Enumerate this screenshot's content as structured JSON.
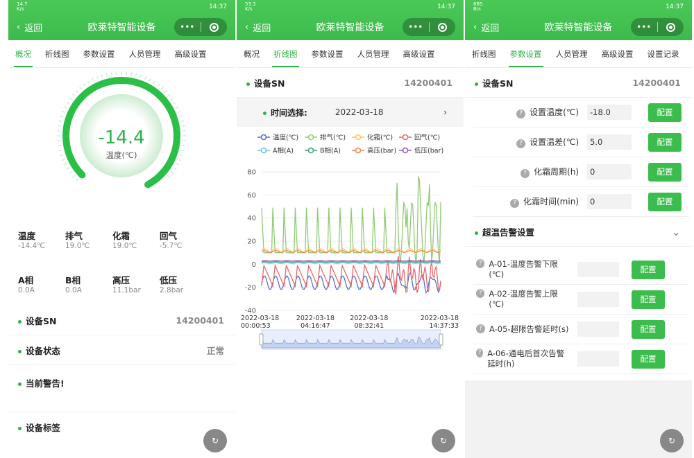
{
  "status": {
    "p1": {
      "net": "14.7\nK/s",
      "time": "14:37"
    },
    "p2": {
      "net": "53.3\nK/s",
      "time": "14:37"
    },
    "p3": {
      "net": "685\nB/s",
      "time": "14:37"
    }
  },
  "nav": {
    "back": "返回",
    "title": "欧莱特智能设备"
  },
  "p1": {
    "tabs": [
      "概况",
      "折线图",
      "参数设置",
      "人员管理",
      "高级设置"
    ],
    "gauge": {
      "value": "-14.4",
      "unit": "温度(℃)"
    },
    "metrics1": [
      {
        "label": "温度",
        "value": "-14.4℃"
      },
      {
        "label": "排气",
        "value": "19.0℃"
      },
      {
        "label": "化霜",
        "value": "19.0℃"
      },
      {
        "label": "回气",
        "value": "-5.7℃"
      }
    ],
    "metrics2": [
      {
        "label": "A相",
        "value": "0.0A"
      },
      {
        "label": "B相",
        "value": "0.0A"
      },
      {
        "label": "高压",
        "value": "11.1bar"
      },
      {
        "label": "低压",
        "value": "2.8bar"
      }
    ],
    "sn_label": "设备SN",
    "sn_value": "14200401",
    "status_label": "设备状态",
    "status_value": "正常",
    "alarm_label": "当前警告!",
    "tag_label": "设备标签"
  },
  "p2": {
    "tabs": [
      "概况",
      "折线图",
      "参数设置",
      "人员管理",
      "高级设置"
    ],
    "sn_label": "设备SN",
    "sn_value": "14200401",
    "time_label": "时间选择:",
    "time_value": "2022-03-18"
  },
  "p3": {
    "tabs": [
      "折线图",
      "参数设置",
      "人员管理",
      "高级设置",
      "设置记录"
    ],
    "sn_label": "设备SN",
    "sn_value": "14200401",
    "params": [
      {
        "label": "设置温度(℃)",
        "value": "-18.0",
        "btn": "配置"
      },
      {
        "label": "设置温差(℃)",
        "value": "5.0",
        "btn": "配置"
      },
      {
        "label": "化霜周期(h)",
        "value": "0",
        "btn": "配置"
      },
      {
        "label": "化霜时间(min)",
        "value": "0",
        "btn": "配置"
      }
    ],
    "alarm_section": "超温告警设置",
    "alarms": [
      {
        "label": "A-01-温度告警下限(℃)",
        "btn": "配置"
      },
      {
        "label": "A-02-温度告警上限(℃)",
        "btn": "配置"
      },
      {
        "label": "A-05-超限告警延时(s)",
        "btn": "配置"
      },
      {
        "label": "A-06-通电后首次告警延时(h)",
        "btn": "配置"
      }
    ]
  },
  "chart_data": {
    "type": "line",
    "ylim": [
      -40,
      80
    ],
    "yticks": [
      "80",
      "60",
      "40",
      "20",
      "0",
      "-20",
      "-40"
    ],
    "xlabels": [
      [
        "2022-03-18",
        "00:00:53"
      ],
      [
        "2022-03-18",
        "04:16:47"
      ],
      [
        "2022-03-18",
        "08:32:41"
      ],
      [
        "2022-03-18",
        "14:37:33"
      ]
    ],
    "legend": [
      {
        "name": "温度(℃)",
        "color": "#5470c6"
      },
      {
        "name": "排气(℃)",
        "color": "#91cc75"
      },
      {
        "name": "化霜(℃)",
        "color": "#fac858"
      },
      {
        "name": "回气(℃)",
        "color": "#ee6666"
      },
      {
        "name": "A相(A)",
        "color": "#73c0de"
      },
      {
        "name": "B相(A)",
        "color": "#3ba272"
      },
      {
        "name": "高压(bar)",
        "color": "#fc8452"
      },
      {
        "name": "低压(bar)",
        "color": "#9a60b4"
      }
    ],
    "series": [
      {
        "name": "温度(℃)",
        "color": "#5470c6",
        "pattern": "cyc",
        "base": -16,
        "amp": 6
      },
      {
        "name": "排气(℃)",
        "color": "#91cc75",
        "pattern": "spike",
        "base": 10,
        "amp": 30
      },
      {
        "name": "化霜(℃)",
        "color": "#fac858",
        "pattern": "flat",
        "base": 12,
        "amp": 3
      },
      {
        "name": "回气(℃)",
        "color": "#ee6666",
        "pattern": "saw",
        "base": -10,
        "amp": 18
      },
      {
        "name": "A相(A)",
        "color": "#73c0de",
        "pattern": "flat",
        "base": 1,
        "amp": 0.5
      },
      {
        "name": "B相(A)",
        "color": "#3ba272",
        "pattern": "flat",
        "base": 2,
        "amp": 0.5
      },
      {
        "name": "高压(bar)",
        "color": "#fc8452",
        "pattern": "flat",
        "base": 11,
        "amp": 1.5
      },
      {
        "name": "低压(bar)",
        "color": "#9a60b4",
        "pattern": "flat",
        "base": 3,
        "amp": 0.5
      }
    ]
  },
  "fab_icon": "refresh-icon"
}
